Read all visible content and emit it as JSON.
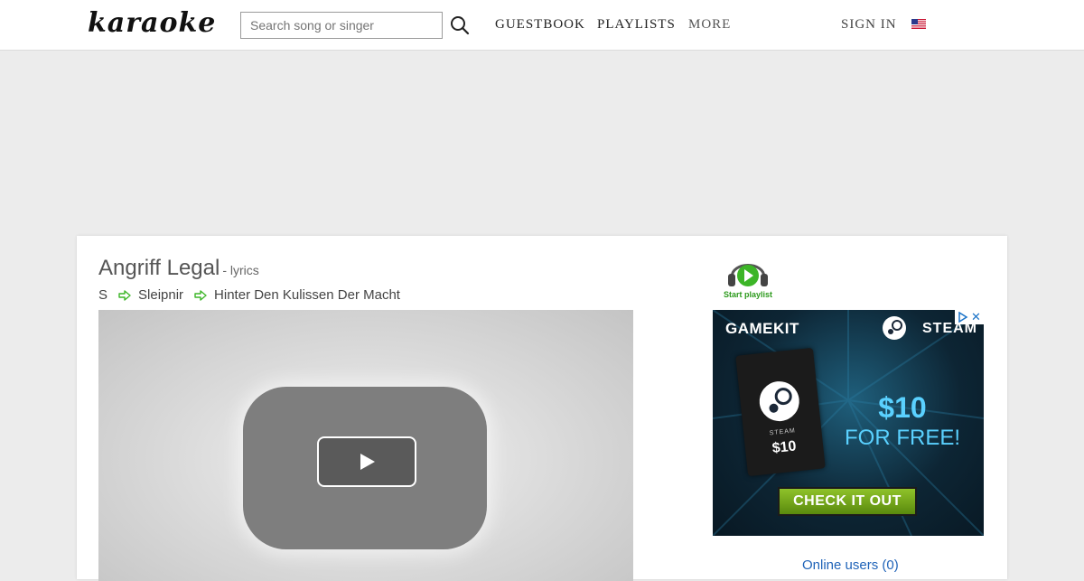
{
  "header": {
    "logo_text": "karaoke",
    "search_placeholder": "Search song or singer",
    "search_icon": "search-icon",
    "nav": {
      "guestbook": "GUESTBOOK",
      "playlists": "PLAYLISTS",
      "more": "MORE"
    },
    "sign_in": "SIGN IN",
    "language_flag": "us-flag-icon"
  },
  "song": {
    "title": "Angriff Legal",
    "suffix": "- lyrics",
    "breadcrumb": [
      "S",
      "Sleipnir",
      "Hinter Den Kulissen Der Macht"
    ]
  },
  "sidebar": {
    "start_playlist_label": "Start playlist",
    "online_users": "Online users (0)"
  },
  "ad": {
    "brand": "GAMEKIT",
    "partner": "STEAM",
    "card_label": "STEAM",
    "card_price": "$10",
    "amount": "$10",
    "offer": "FOR FREE!",
    "cta": "CHECK IT OUT"
  },
  "colors": {
    "accent_green": "#2c9a1c",
    "link_blue": "#1f63b8",
    "ad_blue": "#5ad1ff"
  }
}
